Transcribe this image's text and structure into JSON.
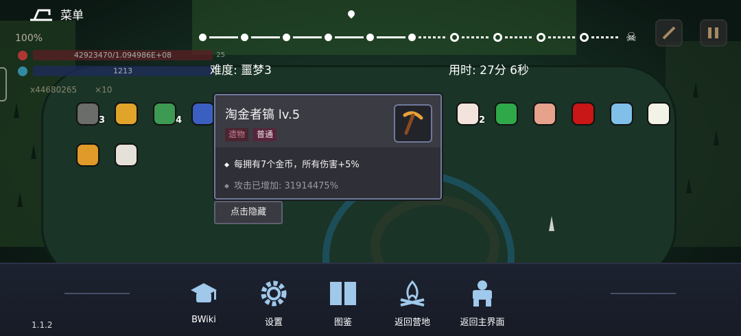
{
  "top": {
    "menu_label": "菜单",
    "zoom": "100%",
    "hp_text": "42923470/1.094986E+08",
    "hp_extra": "25",
    "mp_text": "1213",
    "gold_text": "x44680265",
    "keys_text": "×10"
  },
  "progress": {
    "done_stages": 5,
    "current_stage": 6,
    "remaining_stages": 4,
    "boss_icon": "skull-icon"
  },
  "run": {
    "difficulty": "难度: 噩梦3",
    "time": "用时: 27分 6秒"
  },
  "items": [
    {
      "icon": "plague-mask-icon",
      "count": "3",
      "color": "#6a6d6a"
    },
    {
      "icon": "golden-trophy-icon",
      "count": "",
      "color": "#e0a42a"
    },
    {
      "icon": "green-scarf-icon",
      "count": "4",
      "color": "#3d9a52"
    },
    {
      "icon": "blue-potion-icon",
      "count": "",
      "color": "#3a5fc0"
    },
    {
      "icon": "rabbit-ear-icon",
      "count": "2",
      "color": "#f2e4dc"
    },
    {
      "icon": "four-leaf-clover-icon",
      "count": "",
      "color": "#2fa84a"
    },
    {
      "icon": "meat-creature-icon",
      "count": "",
      "color": "#e7a28c"
    },
    {
      "icon": "red-eye-icon",
      "count": "",
      "color": "#c91616"
    },
    {
      "icon": "magnifier-icon",
      "count": "",
      "color": "#7fbfe8"
    },
    {
      "icon": "winged-boot-icon",
      "count": "",
      "color": "#f2f2e6"
    },
    {
      "icon": "golden-ticket-icon",
      "count": "",
      "color": "#e09a2a"
    },
    {
      "icon": "spiral-glasses-icon",
      "count": "",
      "color": "#e6e1d8"
    }
  ],
  "tooltip": {
    "title": "淘金者镐 lv.5",
    "type_tag": "遗物",
    "rarity_tag": "普通",
    "icon": "pickaxe-icon",
    "effect": "每拥有7个金币，所有伤害+5%",
    "bonus": "攻击已增加: 31914475%",
    "hide_button": "点击隐藏"
  },
  "bottom_nav": [
    {
      "label": "BWiki",
      "icon": "graduation-cap-icon"
    },
    {
      "label": "设置",
      "icon": "gear-icon"
    },
    {
      "label": "图鉴",
      "icon": "book-icon"
    },
    {
      "label": "返回营地",
      "icon": "campfire-icon"
    },
    {
      "label": "返回主界面",
      "icon": "golem-icon"
    }
  ],
  "version": "1.1.2",
  "colors": {
    "accent": "#6f7a9a",
    "nav_icon": "#9fc8ea",
    "relic_tag": "#c87f95",
    "rarity_tag_bg": "#57253a"
  }
}
